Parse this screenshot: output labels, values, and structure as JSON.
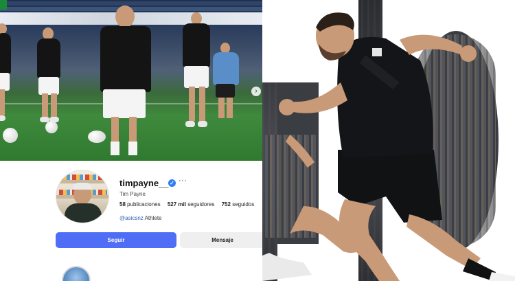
{
  "profile": {
    "username": "timpayne__",
    "verified_mark": "✓",
    "more_menu": "···",
    "full_name": "Tim Payne",
    "stats": {
      "posts_value": "58",
      "posts_label": "publicaciones",
      "followers_value": "527 mil",
      "followers_label": "seguidores",
      "following_value": "752",
      "following_label": "seguidos"
    },
    "bio": {
      "mention": "@asicsnz",
      "text": "Athlete"
    },
    "follow_button": "Seguir",
    "message_button": "Mensaje"
  },
  "carousel": {
    "next_glyph": "›"
  },
  "colors": {
    "accent_button": "#4f6df5",
    "verified_badge": "#2f7ff3",
    "pitch_green": "#3f8a3c",
    "kit_black": "#141414"
  },
  "icons": [
    "verified-badge-icon",
    "more-options-icon",
    "carousel-next-icon"
  ]
}
